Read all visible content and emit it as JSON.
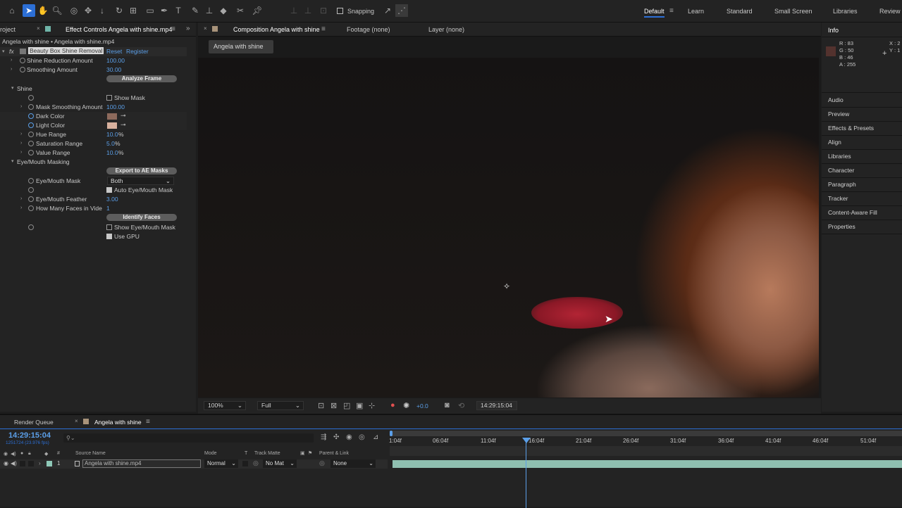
{
  "toolbar": {
    "snapping_label": "Snapping",
    "workspaces": [
      "Default",
      "Learn",
      "Standard",
      "Small Screen",
      "Libraries",
      "Review"
    ]
  },
  "left_panel": {
    "tab_project": "roject",
    "tab_effect_controls": "Effect Controls Angela with shine.mp4",
    "header": "Angela with shine • Angela with shine.mp4",
    "fx_label": "fx",
    "effect_name": "Beauty Box Shine Removal",
    "reset": "Reset",
    "register": "Register",
    "rows": {
      "shine_reduction": {
        "label": "Shine Reduction Amount",
        "value": "100.00"
      },
      "smoothing": {
        "label": "Smoothing Amount",
        "value": "30.00"
      },
      "analyze": "Analyze Frame",
      "shine_group": "Shine",
      "show_mask": "Show Mask",
      "mask_smoothing": {
        "label": "Mask Smoothing Amount",
        "value": "100.00"
      },
      "dark_color": {
        "label": "Dark Color",
        "swatch": "#8d6a5c"
      },
      "light_color": {
        "label": "Light Color",
        "swatch": "#d8b19e"
      },
      "hue_range": {
        "label": "Hue Range",
        "value": "10.0",
        "unit": "%"
      },
      "saturation_range": {
        "label": "Saturation Range",
        "value": "5.0",
        "unit": "%"
      },
      "value_range": {
        "label": "Value Range",
        "value": "10.0",
        "unit": "%"
      },
      "eye_mouth_group": "Eye/Mouth Masking",
      "export_masks": "Export to AE Masks",
      "eye_mouth_mask": {
        "label": "Eye/Mouth Mask",
        "value": "Both"
      },
      "auto_mask": "Auto Eye/Mouth Mask",
      "feather": {
        "label": "Eye/Mouth Feather",
        "value": "3.00"
      },
      "faces": {
        "label": "How Many Faces in Vide",
        "value": "1"
      },
      "identify": "Identify Faces",
      "show_eye_mouth": "Show Eye/Mouth Mask",
      "use_gpu": "Use GPU"
    }
  },
  "composition": {
    "tab_label": "Composition Angela with shine",
    "footage_tab": "Footage (none)",
    "layer_tab": "Layer (none)",
    "breadcrumb": "Angela with shine",
    "zoom": "100%",
    "resolution": "Full",
    "exposure": "+0.0",
    "timecode": "14:29:15:04"
  },
  "info_panel": {
    "title": "Info",
    "r": "R : 83",
    "g": "G : 50",
    "b": "B : 46",
    "a": "A : 255",
    "x": "X : 2",
    "y": "Y : 1",
    "swatch": "#53322e"
  },
  "right_panel_items": [
    "Audio",
    "Preview",
    "Effects & Presets",
    "Align",
    "Libraries",
    "Character",
    "Paragraph",
    "Tracker",
    "Content-Aware Fill",
    "Properties"
  ],
  "timeline": {
    "render_queue_tab": "Render Queue",
    "comp_tab": "Angela with shine",
    "timecode": "14:29:15:04",
    "frame_info": "1251724 (23.976 fps)",
    "search_placeholder": "",
    "columns": {
      "hash": "#",
      "source_name": "Source Name",
      "mode": "Mode",
      "t": "T",
      "track_matte": "Track Matte",
      "parent": "Parent & Link"
    },
    "layer": {
      "index": "1",
      "name": "Angela with shine.mp4",
      "mode": "Normal",
      "matte": "No Mat",
      "parent": "None"
    },
    "ruler": [
      "1:04f",
      "06:04f",
      "11:04f",
      "16:04f",
      "21:04f",
      "26:04f",
      "31:04f",
      "36:04f",
      "41:04f",
      "46:04f",
      "51:04f"
    ]
  }
}
